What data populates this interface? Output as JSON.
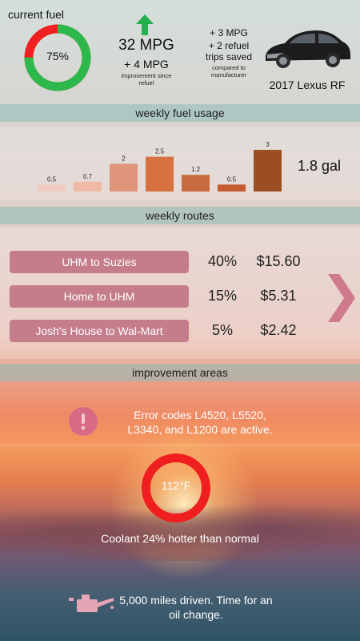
{
  "fuel": {
    "title": "current fuel",
    "percent_label": "75%",
    "level_percent": 75,
    "colors": {
      "filled": "#2db84b",
      "empty": "#f02020"
    }
  },
  "mpg": {
    "value": "32 MPG",
    "change": "+ 4 MPG",
    "note_line1": "improvement since",
    "note_line2": "refuel",
    "arrow_icon": "up-arrow-icon",
    "arrow_color": "#22b14c"
  },
  "savings": {
    "line1": "+ 3 MPG",
    "line2": "+ 2 refuel",
    "line3": "trips saved",
    "compared_line1": "compared to",
    "compared_line2": "manufacturer"
  },
  "car": {
    "icon": "car-image",
    "name": "2017 Lexus RF"
  },
  "sections": {
    "weekly_fuel": "weekly fuel usage",
    "weekly_routes": "weekly routes",
    "improvement": "improvement areas"
  },
  "chart_data": {
    "type": "bar",
    "values": [
      0.5,
      0.7,
      2,
      2.5,
      1.2,
      0.5,
      3
    ],
    "labels": [
      "0.5",
      "0.7",
      "2",
      "2.5",
      "1.2",
      "0.5",
      "3"
    ],
    "colors": [
      "#f0cbbf",
      "#f0b9a6",
      "#e0957b",
      "#d7713f",
      "#c76c3e",
      "#c55a2e",
      "#9a4e22"
    ],
    "summary": "1.8 gal"
  },
  "routes": [
    {
      "name": "UHM to Suzies",
      "percent": "40%",
      "cost": "$15.60"
    },
    {
      "name": "Home to UHM",
      "percent": "15%",
      "cost": "$5.31"
    },
    {
      "name": "Josh's House to Wal-Mart",
      "percent": "5%",
      "cost": "$2.42"
    }
  ],
  "routes_next_icon": "chevron-right-icon",
  "alerts": {
    "error_icon": "exclamation-icon",
    "error_line1": "Error codes L4520, L5520,",
    "error_line2": "L3340, and L1200 are active.",
    "temp_label": "112°F",
    "coolant": "Coolant 24% hotter than normal",
    "oil_icon": "oil-can-icon",
    "oil_line1": "5,000 miles driven. Time for an",
    "oil_line2": "oil change."
  }
}
